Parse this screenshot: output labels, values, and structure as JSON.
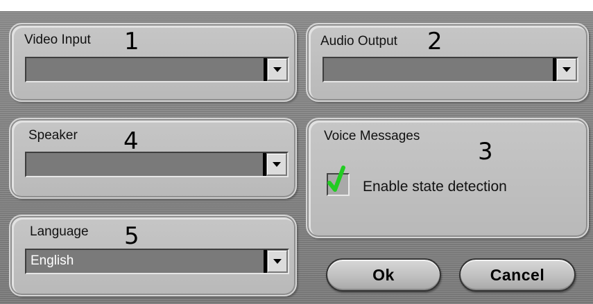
{
  "video_input": {
    "label": "Video Input",
    "number": "1",
    "value": ""
  },
  "audio_output": {
    "label": "Audio Output",
    "number": "2",
    "value": ""
  },
  "voice_messages": {
    "label": "Voice Messages",
    "number": "3",
    "checkbox_label": "Enable state detection",
    "checked": true
  },
  "speaker": {
    "label": "Speaker",
    "number": "4",
    "value": ""
  },
  "language": {
    "label": "Language",
    "number": "5",
    "value": "English"
  },
  "buttons": {
    "ok": "Ok",
    "cancel": "Cancel"
  },
  "colors": {
    "panel": "#c0c0c0",
    "background": "#858585",
    "check": "#22cc22"
  },
  "icons": {
    "dropdown": "chevron-down-icon",
    "check": "checkmark-icon"
  }
}
